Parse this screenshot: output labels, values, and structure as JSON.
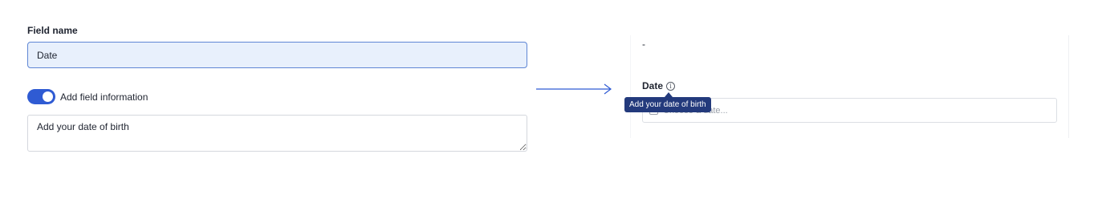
{
  "editor": {
    "field_name_label": "Field name",
    "field_name_value": "Date",
    "toggle_label": "Add field information",
    "toggle_on": true,
    "info_text": "Add your date of birth"
  },
  "preview": {
    "dash": "-",
    "date_label": "Date",
    "date_placeholder": "Choose a date...",
    "tooltip": "Add your date of birth",
    "info_icon_glyph": "i"
  },
  "colors": {
    "accent": "#2f5bd3",
    "tooltip_bg": "#233a7c",
    "input_bg": "#e8f0fc",
    "input_border": "#5f86d4"
  },
  "icons": [
    "info-icon",
    "calendar-icon",
    "right-arrow-icon"
  ]
}
